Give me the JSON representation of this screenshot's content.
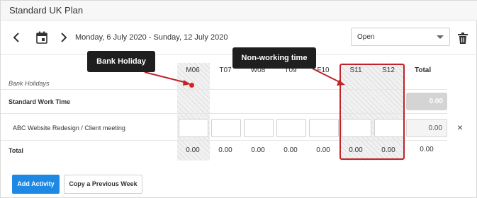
{
  "plan": {
    "title": "Standard UK Plan"
  },
  "toolbar": {
    "date_range": "Monday, 6 July 2020 - Sunday, 12 July 2020",
    "status_value": "Open",
    "icons": {
      "prev": "chevron-left-icon",
      "calendar": "calendar-icon",
      "next": "chevron-right-icon",
      "delete": "trash-icon"
    }
  },
  "grid": {
    "columns": [
      "M06",
      "T07",
      "W08",
      "T09",
      "F10",
      "S11",
      "S12"
    ],
    "total_header": "Total",
    "rows": {
      "bank_holidays": "Bank Holidays",
      "standard_work_time": "Standard Work Time",
      "activity": "ABC Website Redesign / Client meeting",
      "total": "Total"
    },
    "standard_total": "0.00",
    "activity_total": "0.00",
    "day_totals": [
      "0.00",
      "0.00",
      "0.00",
      "0.00",
      "0.00",
      "0.00",
      "0.00"
    ],
    "grand_total": "0.00"
  },
  "callouts": {
    "bank_holiday": "Bank Holiday",
    "non_working": "Non-working time"
  },
  "actions": {
    "add_activity": "Add Activity",
    "copy_previous": "Copy a Previous Week"
  },
  "colors": {
    "accent": "#1e88e5",
    "highlight": "#c0232a",
    "holiday_dot": "#e02020"
  }
}
